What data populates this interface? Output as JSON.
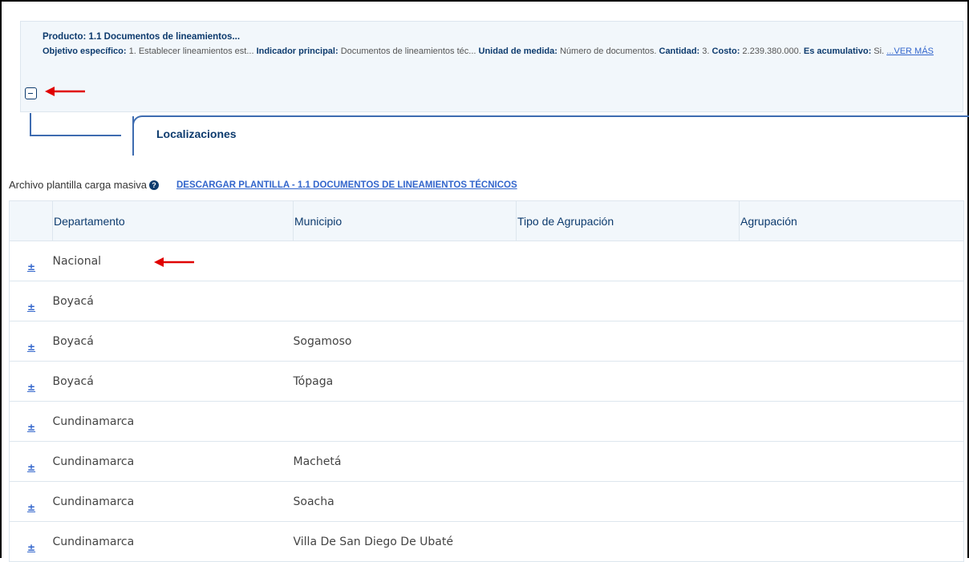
{
  "product": {
    "title": "Producto: 1.1 Documentos de lineamientos...",
    "objective_label": "Objetivo específico:",
    "objective_value": " 1. Establecer lineamientos est... ",
    "indicator_label": "Indicador principal:",
    "indicator_value": " Documentos de lineamientos téc... ",
    "unit_label": "Unidad de medida:",
    "unit_value": " Número de documentos. ",
    "quantity_label": "Cantidad:",
    "quantity_value": " 3. ",
    "cost_label": "Costo:",
    "cost_value": " 2.239.380.000. ",
    "cumulative_label": "Es acumulativo:",
    "cumulative_value": " Si. ",
    "ver_mas": "...VER MÁS"
  },
  "tab": {
    "label": "Localizaciones"
  },
  "template": {
    "label": "Archivo plantilla carga masiva",
    "help_icon": "question-circle-icon",
    "download_link": "DESCARGAR PLANTILLA - 1.1 DOCUMENTOS DE LINEAMIENTOS TÉCNICOS"
  },
  "table": {
    "columns": [
      "Departamento",
      "Municipio",
      "Tipo de Agrupación",
      "Agrupación"
    ],
    "expand_icon": "±",
    "rows": [
      [
        "Nacional",
        "",
        "",
        ""
      ],
      [
        "Boyacá",
        "",
        "",
        ""
      ],
      [
        "Boyacá",
        "Sogamoso",
        "",
        ""
      ],
      [
        "Boyacá",
        "Tópaga",
        "",
        ""
      ],
      [
        "Cundinamarca",
        "",
        "",
        ""
      ],
      [
        "Cundinamarca",
        "Machetá",
        "",
        ""
      ],
      [
        "Cundinamarca",
        "Soacha",
        "",
        ""
      ],
      [
        "Cundinamarca",
        "Villa De San Diego De Ubaté",
        "",
        ""
      ]
    ]
  },
  "colors": {
    "brand_dark": "#0d3b6e",
    "link": "#3366cc",
    "annotation_arrow": "#e00000"
  }
}
